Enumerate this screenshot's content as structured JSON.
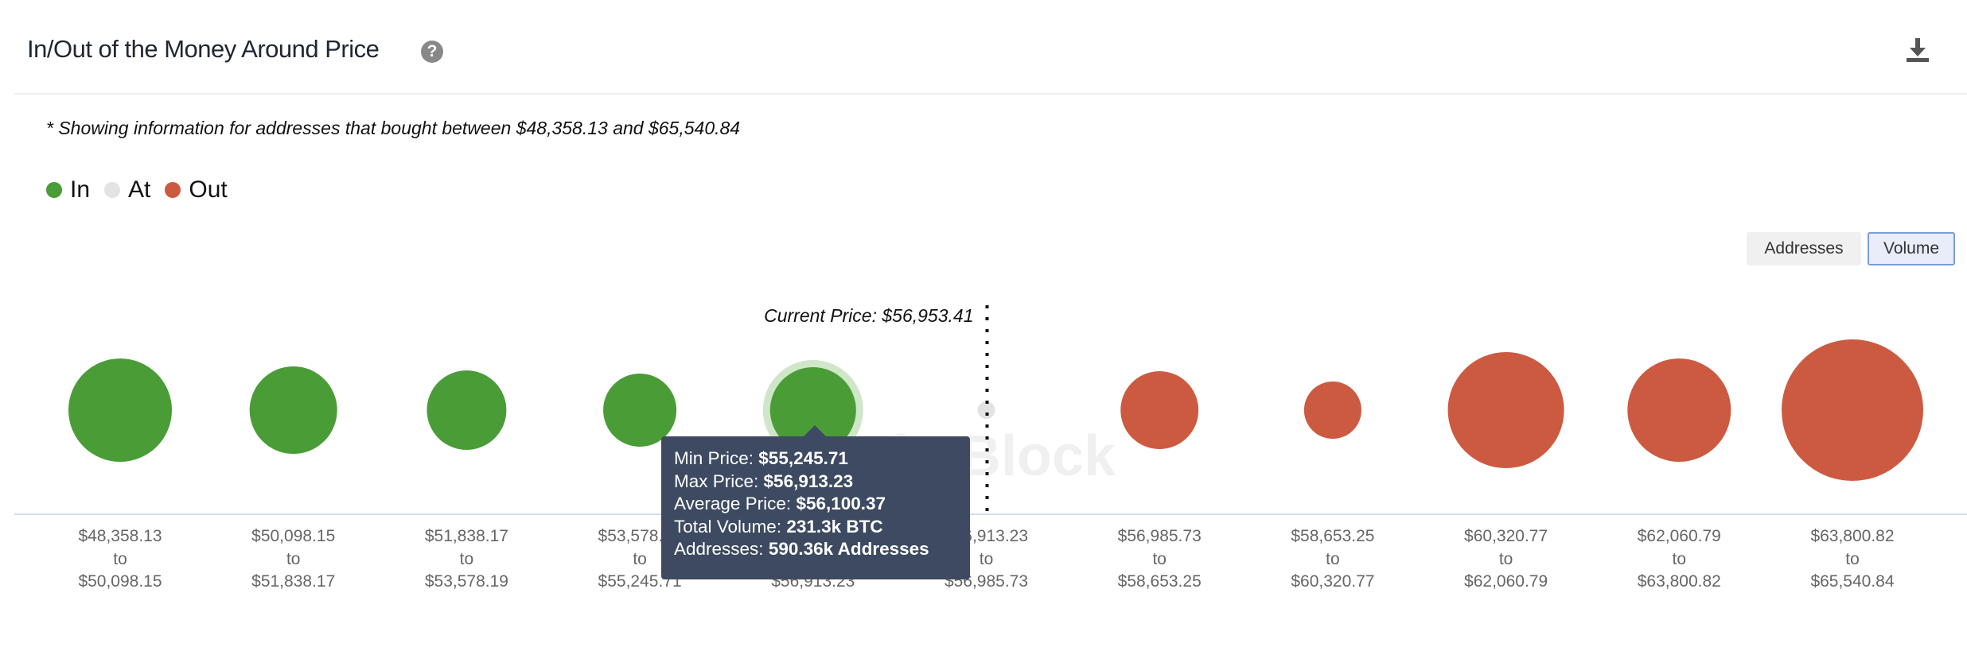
{
  "header": {
    "title": "In/Out of the Money Around Price",
    "help_icon": "question-circle-icon",
    "download_icon": "download-icon"
  },
  "note": "* Showing information for addresses that bought between $48,358.13 and $65,540.84",
  "legend": [
    {
      "label": "In",
      "color": "#4a9c37"
    },
    {
      "label": "At",
      "color": "#e3e3e3"
    },
    {
      "label": "Out",
      "color": "#cc5a41"
    }
  ],
  "toggle": {
    "addresses_label": "Addresses",
    "volume_label": "Volume",
    "selected": "Volume"
  },
  "chart_data": {
    "type": "bubble",
    "current_price_label": "Current Price: $56,953.41",
    "current_price": 56953.41,
    "watermark": "TheBlock",
    "bins": [
      {
        "from": "$48,358.13",
        "to": "$50,098.15",
        "status": "In",
        "volume_k_btc": 335
      },
      {
        "from": "$50,098.15",
        "to": "$51,838.17",
        "status": "In",
        "volume_k_btc": 240
      },
      {
        "from": "$51,838.17",
        "to": "$53,578.19",
        "status": "In",
        "volume_k_btc": 198
      },
      {
        "from": "$53,578.19",
        "to": "$55,245.71",
        "status": "In",
        "volume_k_btc": 168
      },
      {
        "from": "$55,245.71",
        "to": "$56,913.23",
        "status": "In",
        "volume_k_btc": 231.3
      },
      {
        "from": "$56,913.23",
        "to": "$56,985.73",
        "status": "At",
        "volume_k_btc": 9.6
      },
      {
        "from": "$56,985.73",
        "to": "$58,653.25",
        "status": "Out",
        "volume_k_btc": 190
      },
      {
        "from": "$58,653.25",
        "to": "$60,320.77",
        "status": "Out",
        "volume_k_btc": 103
      },
      {
        "from": "$60,320.77",
        "to": "$62,060.79",
        "status": "Out",
        "volume_k_btc": 423
      },
      {
        "from": "$62,060.79",
        "to": "$63,800.82",
        "status": "Out",
        "volume_k_btc": 335
      },
      {
        "from": "$63,800.82",
        "to": "$65,540.84",
        "status": "Out",
        "volume_k_btc": 628
      }
    ],
    "to_word": "to",
    "tooltip": {
      "rows": [
        {
          "label": "Min Price:",
          "value": "$55,245.71"
        },
        {
          "label": "Max Price:",
          "value": "$56,913.23"
        },
        {
          "label": "Average Price:",
          "value": "$56,100.37"
        },
        {
          "label": "Total Volume:",
          "value": "231.3k BTC"
        },
        {
          "label": "Addresses:",
          "value": "590.36k Addresses"
        }
      ],
      "hovered_index": 4
    }
  }
}
